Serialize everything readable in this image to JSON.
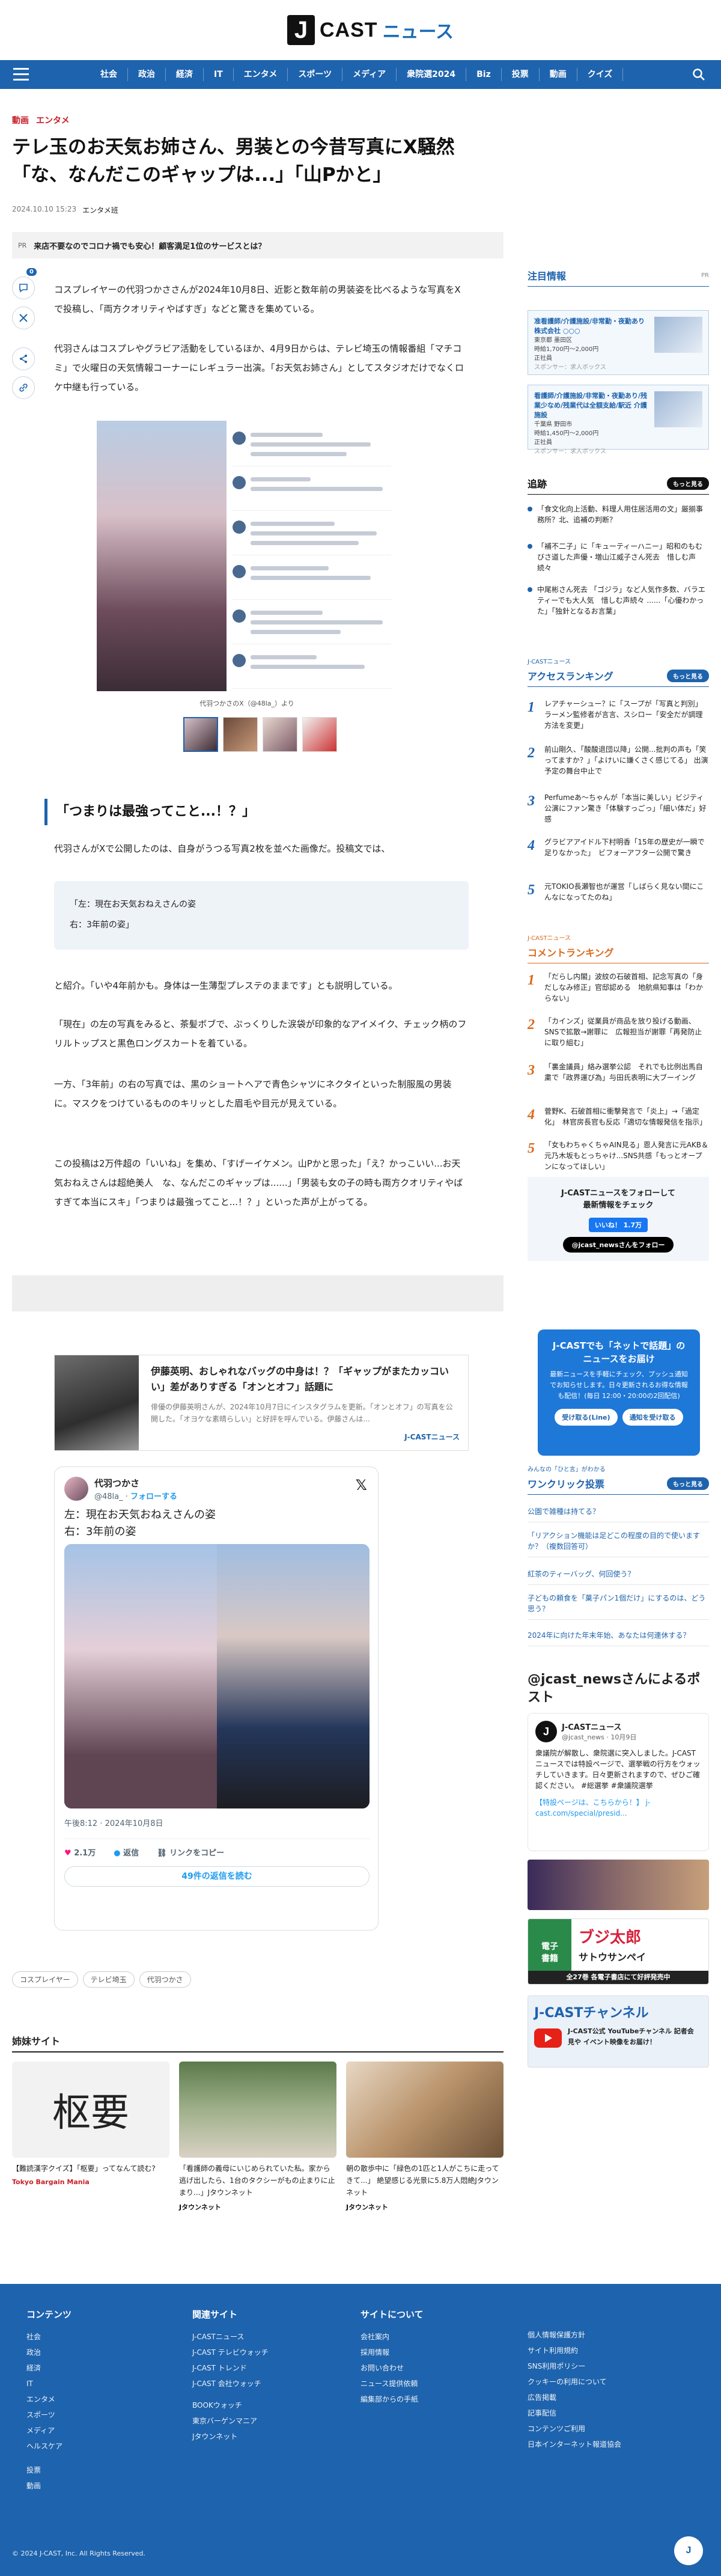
{
  "header": {
    "logo_j": "J",
    "logo_cast": "CAST",
    "logo_news": "ニュース",
    "nav": [
      "社会",
      "政治",
      "経済",
      "IT",
      "エンタメ",
      "スポーツ",
      "メディア",
      "衆院選2024",
      "Biz",
      "投票",
      "動画",
      "クイズ"
    ]
  },
  "article": {
    "categories": [
      "動画",
      "エンタメ"
    ],
    "title": "テレ玉のお天気お姉さん、男装との今昔写真にX騒然「な、なんだこのギャップは...」「山Pかと」",
    "date": "2024.10.10 15:23",
    "writer": "エンタメ班",
    "pr_label": "PR",
    "pr_text": "来店不要なのでコロナ禍でも安心！顧客満足1位のサービスとは？",
    "comment_count": "0",
    "p1": "コスプレイヤーの代羽つかささんが2024年10月8日、近影と数年前の男装姿を比べるような写真をXで投稿し、「両方クオリティやばすぎ」などと驚きを集めている。",
    "p2": "代羽さんはコスプレやグラビア活動をしているほか、4月9日からは、テレビ埼玉の情報番組「マチコミ」で火曜日の天気情報コーナーにレギュラー出演。「お天気お姉さん」としてスタジオだけでなくロケ中継も行っている。",
    "caption": "代羽つかさのX（@48la_）より",
    "section_heading": "「つまりは最強ってこと...！？」",
    "p3": "代羽さんがXで公開したのは、自身がうつる写真2枚を並べた画像だ。投稿文では、",
    "quote_l1": "「左：現在お天気おねえさんの姿",
    "quote_l2": "右：3年前の姿」",
    "p4": "と紹介。「いや4年前かも。身体は一生薄型プレステのままです」とも説明している。",
    "p5": "「現在」の左の写真をみると、茶髪ボブで、ぷっくりした涙袋が印象的なアイメイク、チェック柄のフリルトップスと黒色ロングスカートを着ている。",
    "p6": "一方、「3年前」の右の写真では、黒のショートヘアで青色シャツにネクタイといった制服風の男装に。マスクをつけているもののキリッとした眉毛や目元が見えている。",
    "p7": "この投稿は2万件超の「いいね」を集め、「すげーイケメン。山Pかと思った」「え？かっこいい...お天気おねえさんは超絶美人　な、なんだこのギャップは......」「男装も女の子の時も両方クオリティやばすぎて本当にスキ」「つまりは最強ってこと...！？」といった声が上がってる。",
    "tags": [
      "コスプレイヤー",
      "テレビ埼玉",
      "代羽つかさ"
    ]
  },
  "related": {
    "title": "伊藤英明、おしゃれなバッグの中身は！？「ギャップがまたカッコいい」差がありすぎる「オンとオフ」話題に",
    "desc": "俳優の伊藤英明さんが、2024年10月7日にインスタグラムを更新。「オンとオフ」の写真を公開した。「オヨケな素晴らしい」と好評を呼んでいる。伊藤さんは...",
    "source": "J-CASTニュース"
  },
  "tweet": {
    "name": "代羽つかさ",
    "handle": "@48la_",
    "follow": "フォローする",
    "line1": "左：現在お天気おねえさんの姿",
    "line2": "右：3年前の姿",
    "time": "午後8:12 · 2024年10月8日",
    "likes": "2.1万",
    "reply": "返信",
    "copy": "リンクをコピー",
    "replies": "49件の返信を読む"
  },
  "sister": {
    "heading": "姉妹サイト",
    "items": [
      {
        "title": "【難読漢字クイズ】「枢要」ってなんて読む?",
        "source": "Tokyo Bargain Mania",
        "kanji": "枢要"
      },
      {
        "title": "「看護師の義母にいじめられていた私。家から逃げ出したら、1台のタクシーがもの止まりに止まり...」Jタウンネット",
        "source": "Jタウンネット"
      },
      {
        "title": "朝の散歩中に「緑色の1匹と1人がこちに走ってきて...」 絶望感じる光景に5.8万人悶絶Jタウンネット",
        "source": "Jタウンネット"
      }
    ]
  },
  "sidebar": {
    "notice_h": "注目情報",
    "notice_pr": "PR",
    "jobs": [
      {
        "title": "准看護師/介護施設/非常勤・夜勤あり 株式会社 ○○○",
        "loc": "東京都 墨田区",
        "pay": "時給1,700円〜2,000円",
        "type": "正社員",
        "sponsor": "スポンサー：求人ボックス"
      },
      {
        "title": "看護師/介護施設/非常勤・夜勤あり/残業少なめ/残業代は全額支給/駅近 介護施設",
        "loc": "千葉県 野田市",
        "pay": "時給1,450円〜2,000円",
        "type": "正社員",
        "sponsor": "スポンサー：求人ボックス"
      }
    ],
    "news_h": "追跡",
    "news_more": "もっと見る",
    "news": [
      "「食文化向上活動、料理人用住居活用の文」厳揃事務所？北、追補の判断？",
      "「補不二子」に「キューティーハニー」昭和のもむびさ道した声優・増山江威子さん死去　惜しむ声続々",
      "中尾彬さん死去 「ゴジラ」など人気作多数、バラエティーでも大人気　惜しむ声続々 ......「心優わかった」「独針となるお言葉」"
    ],
    "access_h": "アクセスランキング",
    "access_src": "J-CASTニュース",
    "access": [
      "レアチャーシュー？に「スープが「写真と判別」　ラーメン監修者が言言、スシロー「安全だが調理方法を変更」",
      "前山剛久、「酸酸退団以降」公開...批判の声も「笑ってますか？」「よけいに嫌くさく感じてる」 出演予定の舞台中止で",
      "Perfumeあ〜ちゃんが「本当に美しい」ビジティ公演にファン驚き「体験すっごっ」「細い体だ」好感",
      "グラビアアイドル下村明香「15年の歴史が一瞬で足りなかった」　ビフォーアフター公開で驚き",
      "元TOKIO長瀬智也が運営「しばらく見ない間にこんなになってたのね」"
    ],
    "comment_h": "コメントランキング",
    "comment_src": "J-CASTニュース",
    "comments": [
      "「だらし内閣」波紋の石破首相、記念写真の「身だしなみ修正」官邸認める　地航県知事は「わからない」",
      "「カインズ」従業員が商品を放り投げる動画、SNSで拡散→謝罪に　広報担当が謝罪「再発防止に取り組む」",
      "「裏金議員」絡み選挙公認　それでも比例出馬自粛で「政界運び為」与田氏表明に大ブーイング",
      "菅野K、石破首相に衝撃発言で「炎上」→「過定化」　林官房長官も反応「適切な情報発信を指示」",
      "「女もわちゃくちゃAIN見る」恩人発言に元AKB＆元乃木坂もとっちゃけ...SNS共感「もっとオープンになってほしい」"
    ],
    "follow_t1": "J-CASTニュースをフォローして",
    "follow_t2": "最新情報をチェック",
    "fb_label": "いいね！ 1.7万",
    "x_label": "@jcast_newsさんをフォロー",
    "line_t1": "J-CASTでも「ネットで話題」の",
    "line_t2": "ニュースをお届け",
    "line_d": "最新ニュースを手軽にチェック、プッシュ通知でお知らせします。日々更新されるお得な情報も配信！(毎日 12:00・20:00の2回配信)",
    "line_b1": "受け取る(Line)",
    "line_b2": "通知を受け取る",
    "poll_kicker": "みんなの「ひと言」がわかる",
    "poll_h": "ワンクリック投票",
    "polls": [
      "公園で雑種は持てる？",
      "「リアクション機能は足どこの程度の目的で使いますか？（複数回答可）",
      "紅茶のティーバッグ、何回使う？",
      "子どもの頼食を「菓子パン1個だけ」にするのは、どう思う？",
      "2024年に向けた年末年始、あなたは何連休する？"
    ],
    "xpost_h": "@jcast_newsさんによるポスト",
    "xpost_name": "J-CASTニュース",
    "xpost_handle": "@jcast_news · 10月9日",
    "xpost_text": "衆議院が解散し、衆院選に突入しました。J-CASTニュースでは特設ページで、選挙戦の行方をウォッチしていきます。日々更新されますので、ぜひご確認ください。 #総選挙 #衆議院選挙",
    "xpost_link": "【特設ページは、こちらから！】 j-cast.com/special/presid...",
    "banner1_a": "ブジ太郎",
    "banner1_b": "サトウサンペイ",
    "banner1_c": "全27巻 各電子書店にて好評発売中",
    "banner2": "J-CASTチャンネル",
    "banner2_sub": "J-CAST公式 YouTubeチャンネル 記者会見や イベント映像をお届け！"
  },
  "footer": {
    "c1_h": "コンテンツ",
    "c1": [
      "社会",
      "政治",
      "経済",
      "IT",
      "エンタメ",
      "スポーツ",
      "メディア",
      "ヘルスケア",
      "投票",
      "動画"
    ],
    "c2_h": "関連サイト",
    "c2": [
      "J-CASTニュース",
      "J-CAST テレビウォッチ",
      "J-CAST トレンド",
      "J-CAST 会社ウォッチ",
      "BOOKウォッチ",
      "東京バーゲンマニア",
      "Jタウンネット"
    ],
    "c3_h": "サイトについて",
    "c3": [
      "会社案内",
      "採用情報",
      "お問い合わせ",
      "ニュース提供依頼",
      "編集部からの手紙"
    ],
    "c4": [
      "個人情報保護方針",
      "サイト利用規約",
      "SNS利用ポリシー",
      "クッキーの利用について",
      "広告掲載",
      "記事配信",
      "コンテンツご利用",
      "日本インターネット報道協会"
    ],
    "copyright": "© 2024 J-CAST, Inc. All Rights Reserved."
  }
}
